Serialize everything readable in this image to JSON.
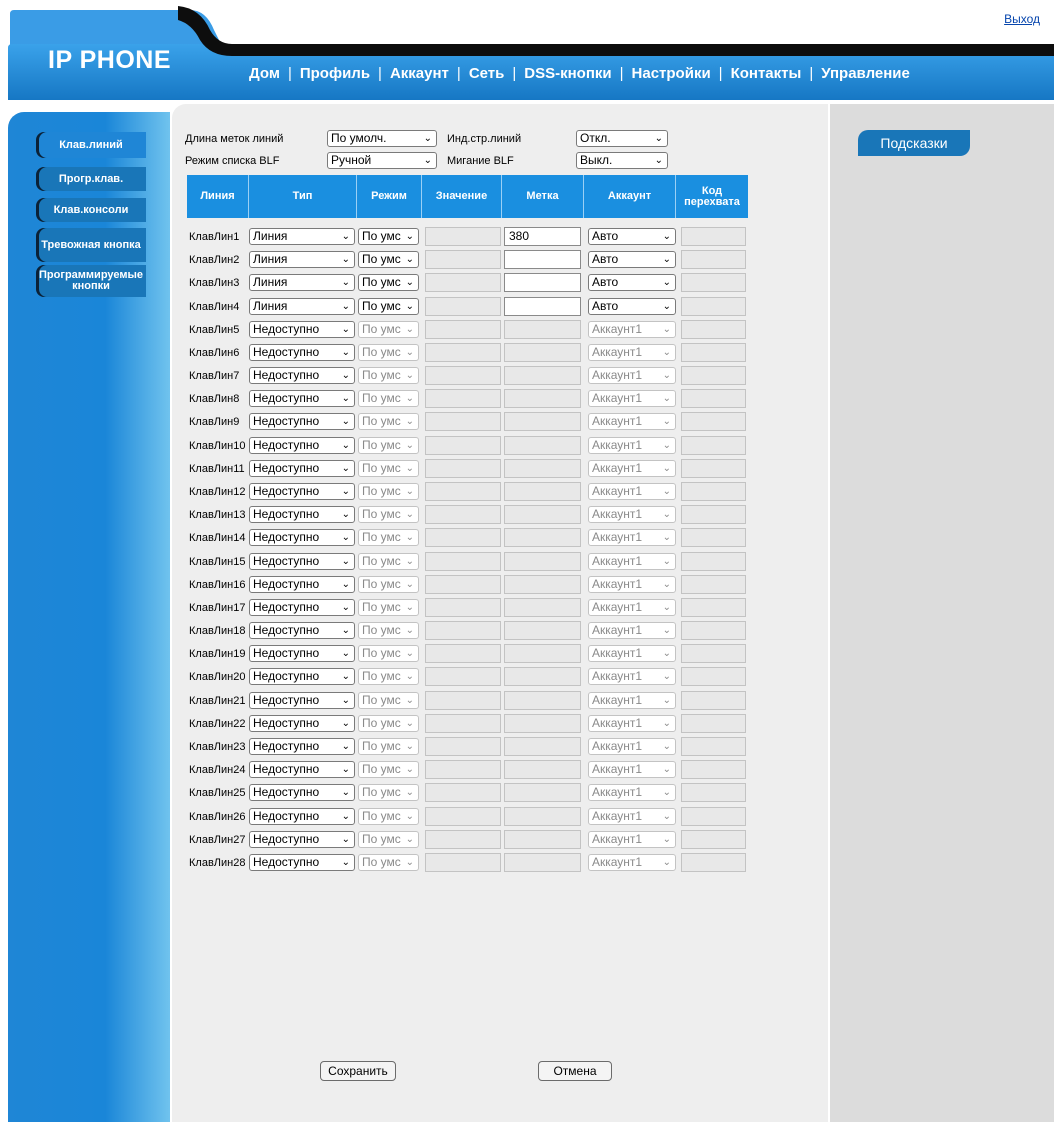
{
  "header": {
    "logout": "Выход",
    "brand": "IP PHONE",
    "nav": [
      "Дом",
      "Профиль",
      "Аккаунт",
      "Сеть",
      "DSS-кнопки",
      "Настройки",
      "Контакты",
      "Управление"
    ]
  },
  "sidebar": {
    "items": [
      "Клав.линий",
      "Прогр.клав.",
      "Клав.консоли",
      "Тревожная кнопка",
      "Программируемые кнопки"
    ]
  },
  "settings": {
    "line_label_length_label": "Длина меток линий",
    "line_label_length_value": "По умолч.",
    "line_page_indicator_label": "Инд.стр.линий",
    "line_page_indicator_value": "Откл.",
    "blf_list_mode_label": "Режим списка BLF",
    "blf_list_mode_value": "Ручной",
    "blf_blink_label": "Мигание BLF",
    "blf_blink_value": "Выкл."
  },
  "table": {
    "headers": [
      "Линия",
      "Тип",
      "Режим",
      "Значение",
      "Метка",
      "Аккаунт",
      "Код перехвата"
    ],
    "rows": [
      {
        "name": "КлавЛин1",
        "type": "Линия",
        "mode": "По умс",
        "value": "",
        "label": "380",
        "account": "Авто",
        "code": "",
        "enabled": true
      },
      {
        "name": "КлавЛин2",
        "type": "Линия",
        "mode": "По умс",
        "value": "",
        "label": "",
        "account": "Авто",
        "code": "",
        "enabled": true
      },
      {
        "name": "КлавЛин3",
        "type": "Линия",
        "mode": "По умс",
        "value": "",
        "label": "",
        "account": "Авто",
        "code": "",
        "enabled": true
      },
      {
        "name": "КлавЛин4",
        "type": "Линия",
        "mode": "По умс",
        "value": "",
        "label": "",
        "account": "Авто",
        "code": "",
        "enabled": true
      },
      {
        "name": "КлавЛин5",
        "type": "Недоступно",
        "mode": "По умс",
        "value": "",
        "label": "",
        "account": "Аккаунт1",
        "code": "",
        "enabled": false
      },
      {
        "name": "КлавЛин6",
        "type": "Недоступно",
        "mode": "По умс",
        "value": "",
        "label": "",
        "account": "Аккаунт1",
        "code": "",
        "enabled": false
      },
      {
        "name": "КлавЛин7",
        "type": "Недоступно",
        "mode": "По умс",
        "value": "",
        "label": "",
        "account": "Аккаунт1",
        "code": "",
        "enabled": false
      },
      {
        "name": "КлавЛин8",
        "type": "Недоступно",
        "mode": "По умс",
        "value": "",
        "label": "",
        "account": "Аккаунт1",
        "code": "",
        "enabled": false
      },
      {
        "name": "КлавЛин9",
        "type": "Недоступно",
        "mode": "По умс",
        "value": "",
        "label": "",
        "account": "Аккаунт1",
        "code": "",
        "enabled": false
      },
      {
        "name": "КлавЛин10",
        "type": "Недоступно",
        "mode": "По умс",
        "value": "",
        "label": "",
        "account": "Аккаунт1",
        "code": "",
        "enabled": false
      },
      {
        "name": "КлавЛин11",
        "type": "Недоступно",
        "mode": "По умс",
        "value": "",
        "label": "",
        "account": "Аккаунт1",
        "code": "",
        "enabled": false
      },
      {
        "name": "КлавЛин12",
        "type": "Недоступно",
        "mode": "По умс",
        "value": "",
        "label": "",
        "account": "Аккаунт1",
        "code": "",
        "enabled": false
      },
      {
        "name": "КлавЛин13",
        "type": "Недоступно",
        "mode": "По умс",
        "value": "",
        "label": "",
        "account": "Аккаунт1",
        "code": "",
        "enabled": false
      },
      {
        "name": "КлавЛин14",
        "type": "Недоступно",
        "mode": "По умс",
        "value": "",
        "label": "",
        "account": "Аккаунт1",
        "code": "",
        "enabled": false
      },
      {
        "name": "КлавЛин15",
        "type": "Недоступно",
        "mode": "По умс",
        "value": "",
        "label": "",
        "account": "Аккаунт1",
        "code": "",
        "enabled": false
      },
      {
        "name": "КлавЛин16",
        "type": "Недоступно",
        "mode": "По умс",
        "value": "",
        "label": "",
        "account": "Аккаунт1",
        "code": "",
        "enabled": false
      },
      {
        "name": "КлавЛин17",
        "type": "Недоступно",
        "mode": "По умс",
        "value": "",
        "label": "",
        "account": "Аккаунт1",
        "code": "",
        "enabled": false
      },
      {
        "name": "КлавЛин18",
        "type": "Недоступно",
        "mode": "По умс",
        "value": "",
        "label": "",
        "account": "Аккаунт1",
        "code": "",
        "enabled": false
      },
      {
        "name": "КлавЛин19",
        "type": "Недоступно",
        "mode": "По умс",
        "value": "",
        "label": "",
        "account": "Аккаунт1",
        "code": "",
        "enabled": false
      },
      {
        "name": "КлавЛин20",
        "type": "Недоступно",
        "mode": "По умс",
        "value": "",
        "label": "",
        "account": "Аккаунт1",
        "code": "",
        "enabled": false
      },
      {
        "name": "КлавЛин21",
        "type": "Недоступно",
        "mode": "По умс",
        "value": "",
        "label": "",
        "account": "Аккаунт1",
        "code": "",
        "enabled": false
      },
      {
        "name": "КлавЛин22",
        "type": "Недоступно",
        "mode": "По умс",
        "value": "",
        "label": "",
        "account": "Аккаунт1",
        "code": "",
        "enabled": false
      },
      {
        "name": "КлавЛин23",
        "type": "Недоступно",
        "mode": "По умс",
        "value": "",
        "label": "",
        "account": "Аккаунт1",
        "code": "",
        "enabled": false
      },
      {
        "name": "КлавЛин24",
        "type": "Недоступно",
        "mode": "По умс",
        "value": "",
        "label": "",
        "account": "Аккаунт1",
        "code": "",
        "enabled": false
      },
      {
        "name": "КлавЛин25",
        "type": "Недоступно",
        "mode": "По умс",
        "value": "",
        "label": "",
        "account": "Аккаунт1",
        "code": "",
        "enabled": false
      },
      {
        "name": "КлавЛин26",
        "type": "Недоступно",
        "mode": "По умс",
        "value": "",
        "label": "",
        "account": "Аккаунт1",
        "code": "",
        "enabled": false
      },
      {
        "name": "КлавЛин27",
        "type": "Недоступно",
        "mode": "По умс",
        "value": "",
        "label": "",
        "account": "Аккаунт1",
        "code": "",
        "enabled": false
      },
      {
        "name": "КлавЛин28",
        "type": "Недоступно",
        "mode": "По умс",
        "value": "",
        "label": "",
        "account": "Аккаунт1",
        "code": "",
        "enabled": false
      }
    ]
  },
  "buttons": {
    "save": "Сохранить",
    "cancel": "Отмена"
  },
  "hints": {
    "title": "Подсказки"
  },
  "colors": {
    "accent": "#1976b8",
    "header_blue": "#1f86d6",
    "table_header": "#1a8fe0",
    "content_bg": "#eeeeee",
    "panel_bg": "#dcdcdc"
  }
}
